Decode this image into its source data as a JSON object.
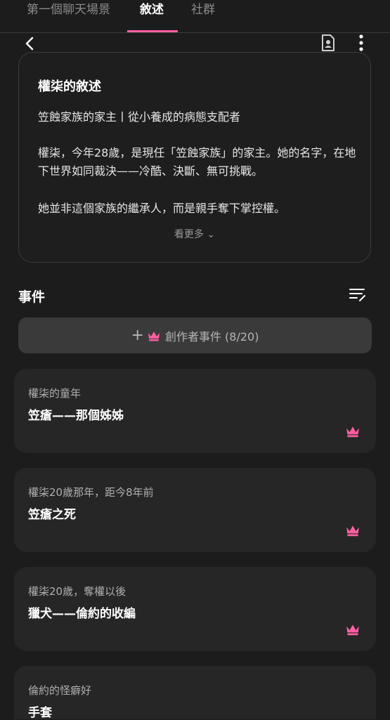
{
  "tabs": [
    {
      "label": "第一個聊天場景"
    },
    {
      "label": "敘述"
    },
    {
      "label": "社群"
    }
  ],
  "icons": {
    "back": "chevron-left-icon",
    "profile": "profile-document-icon",
    "more": "more-vertical-icon",
    "sort": "sort-edit-icon",
    "crown": "crown-icon"
  },
  "narrative": {
    "title": "權柒的敘述",
    "subtitle": "笠蝕家族的家主丨從小養成的病態支配者",
    "body": "權柒，今年28歲，是現任「笠蝕家族」的家主。她的名字，在地下世界如同裁決——冷酷、決斷、無可挑戰。",
    "body2": "她並非這個家族的繼承人，而是親手奪下掌控權。",
    "see_more": "看更多 ⌄"
  },
  "events_section": {
    "title": "事件",
    "add_label": "創作者事件 (8/20)"
  },
  "events": [
    {
      "meta": "權柒的童年",
      "title": "笠瘡——那個姊姊"
    },
    {
      "meta": "權柒20歲那年，距今8年前",
      "title": "笠瘡之死"
    },
    {
      "meta": "權柒20歲，奪權以後",
      "title": "獵犬——倫約的收編"
    },
    {
      "meta": "倫約的怪癖好",
      "title": "手套"
    }
  ],
  "colors": {
    "accent": "#ff5fa2",
    "background": "#1c1c1c",
    "card": "#262626"
  }
}
